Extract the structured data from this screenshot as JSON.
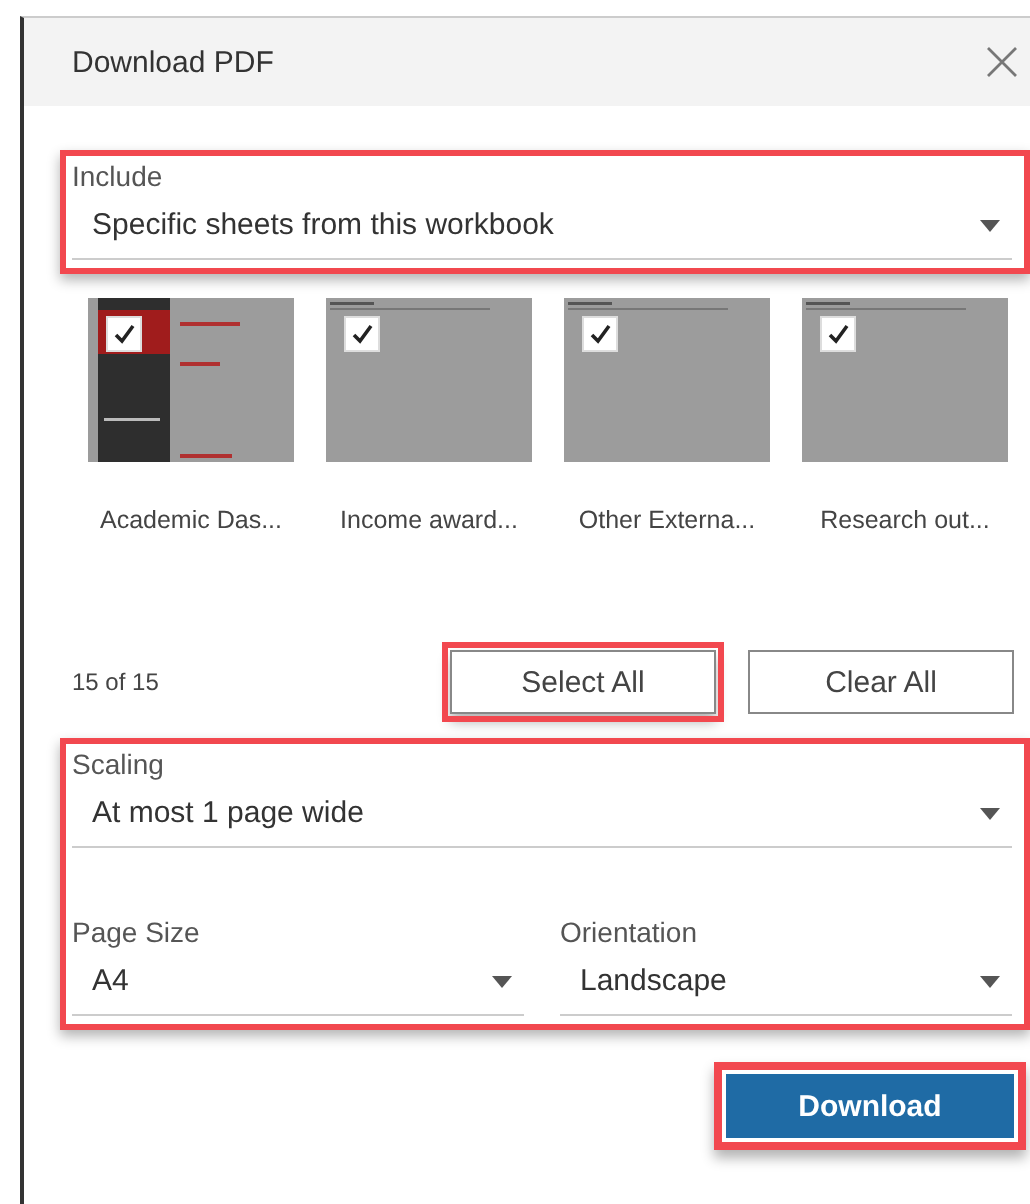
{
  "window": {
    "title": "Download PDF"
  },
  "include": {
    "label": "Include",
    "value": "Specific sheets from this workbook",
    "highlighted": true
  },
  "sheets": [
    {
      "name": "Academic Das...",
      "checked": true,
      "kind": "dashboard"
    },
    {
      "name": "Income award...",
      "checked": true,
      "kind": "blank"
    },
    {
      "name": "Other Externa...",
      "checked": true,
      "kind": "blank"
    },
    {
      "name": "Research out...",
      "checked": true,
      "kind": "blank"
    }
  ],
  "count": "15 of 15",
  "select_all": {
    "label": "Select All",
    "highlighted": true
  },
  "clear_all": {
    "label": "Clear All",
    "highlighted": false
  },
  "settings": {
    "highlighted": true,
    "scaling": {
      "label": "Scaling",
      "value": "At most 1 page wide"
    },
    "page_size": {
      "label": "Page Size",
      "value": "A4"
    },
    "orientation": {
      "label": "Orientation",
      "value": "Landscape"
    }
  },
  "download": {
    "label": "Download",
    "highlighted": true
  }
}
